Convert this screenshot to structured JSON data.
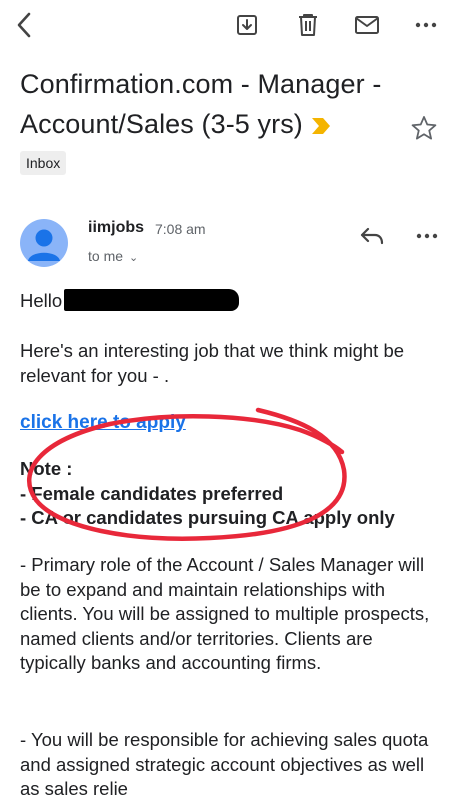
{
  "toolbar": {
    "back": "back-arrow-icon",
    "archive": "archive-icon",
    "delete": "trash-icon",
    "mark_unread": "mail-icon",
    "more": "more-horizontal-icon"
  },
  "email": {
    "subject": "Confirmation.com - Manager - Account/Sales (3-5 yrs)",
    "label": "Inbox",
    "sender": "iimjobs",
    "time": "7:08 am",
    "recipient": "to me",
    "greeting": "Hello",
    "intro": "Here's an interesting job that we think might be relevant for you - .",
    "apply_link": "click here to apply",
    "note_title": "Note :",
    "note_line1": "- Female candidates preferred",
    "note_line2": "- CA or candidates pursuing CA apply only",
    "desc": "- Primary role of the Account / Sales Manager will be to expand and maintain relationships with clients. You will be assigned to multiple prospects, named clients and/or territories. Clients are typically banks and accounting firms.",
    "resp": "- You will be responsible for achieving sales quota and assigned strategic account objectives as well as sales relie"
  },
  "colors": {
    "link": "#1a73e8",
    "importance": "#f4b400",
    "annotation": "#e8283a",
    "avatar": "#8ab4f8"
  }
}
